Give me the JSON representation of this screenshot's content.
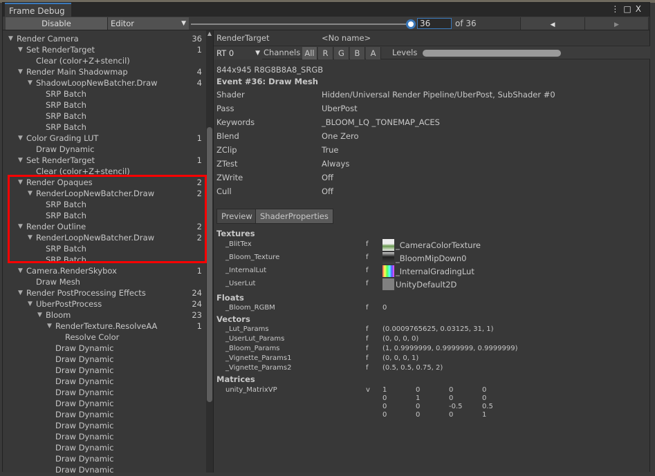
{
  "window": {
    "title": "Frame Debug",
    "menu_icon": "kebab-icon",
    "maximize_icon": "maximize-icon",
    "close_icon": "close-icon"
  },
  "toolbar": {
    "disable_label": "Disable",
    "target_select": "Editor",
    "event_index": "36",
    "event_total": "of 36",
    "event_fraction": 1.0,
    "prev_icon": "arrow-left-icon",
    "next_icon": "arrow-right-icon"
  },
  "tree": [
    {
      "label": "Render Camera",
      "count": "36",
      "level": 0,
      "expandable": true
    },
    {
      "label": "Set RenderTarget",
      "count": "1",
      "level": 1,
      "expandable": true
    },
    {
      "label": "Clear (color+Z+stencil)",
      "count": "",
      "level": 2,
      "expandable": false
    },
    {
      "label": "Render Main Shadowmap",
      "count": "4",
      "level": 1,
      "expandable": true
    },
    {
      "label": "ShadowLoopNewBatcher.Draw",
      "count": "4",
      "level": 2,
      "expandable": true
    },
    {
      "label": "SRP Batch",
      "count": "",
      "level": 3,
      "expandable": false
    },
    {
      "label": "SRP Batch",
      "count": "",
      "level": 3,
      "expandable": false
    },
    {
      "label": "SRP Batch",
      "count": "",
      "level": 3,
      "expandable": false
    },
    {
      "label": "SRP Batch",
      "count": "",
      "level": 3,
      "expandable": false
    },
    {
      "label": "Color Grading LUT",
      "count": "1",
      "level": 1,
      "expandable": true
    },
    {
      "label": "Draw Dynamic",
      "count": "",
      "level": 2,
      "expandable": false
    },
    {
      "label": "Set RenderTarget",
      "count": "1",
      "level": 1,
      "expandable": true
    },
    {
      "label": "Clear (color+Z+stencil)",
      "count": "",
      "level": 2,
      "expandable": false
    },
    {
      "label": "Render Opaques",
      "count": "2",
      "level": 1,
      "expandable": true
    },
    {
      "label": "RenderLoopNewBatcher.Draw",
      "count": "2",
      "level": 2,
      "expandable": true
    },
    {
      "label": "SRP Batch",
      "count": "",
      "level": 3,
      "expandable": false
    },
    {
      "label": "SRP Batch",
      "count": "",
      "level": 3,
      "expandable": false
    },
    {
      "label": "Render Outline",
      "count": "2",
      "level": 1,
      "expandable": true
    },
    {
      "label": "RenderLoopNewBatcher.Draw",
      "count": "2",
      "level": 2,
      "expandable": true
    },
    {
      "label": "SRP Batch",
      "count": "",
      "level": 3,
      "expandable": false
    },
    {
      "label": "SRP Batch",
      "count": "",
      "level": 3,
      "expandable": false
    },
    {
      "label": "Camera.RenderSkybox",
      "count": "1",
      "level": 1,
      "expandable": true
    },
    {
      "label": "Draw Mesh",
      "count": "",
      "level": 2,
      "expandable": false
    },
    {
      "label": "Render PostProcessing Effects",
      "count": "24",
      "level": 1,
      "expandable": true
    },
    {
      "label": "UberPostProcess",
      "count": "24",
      "level": 2,
      "expandable": true
    },
    {
      "label": "Bloom",
      "count": "23",
      "level": 3,
      "expandable": true
    },
    {
      "label": "RenderTexture.ResolveAA",
      "count": "1",
      "level": 4,
      "expandable": true
    },
    {
      "label": "Resolve Color",
      "count": "",
      "level": 5,
      "expandable": false
    },
    {
      "label": "Draw Dynamic",
      "count": "",
      "level": 4,
      "expandable": false
    },
    {
      "label": "Draw Dynamic",
      "count": "",
      "level": 4,
      "expandable": false
    },
    {
      "label": "Draw Dynamic",
      "count": "",
      "level": 4,
      "expandable": false
    },
    {
      "label": "Draw Dynamic",
      "count": "",
      "level": 4,
      "expandable": false
    },
    {
      "label": "Draw Dynamic",
      "count": "",
      "level": 4,
      "expandable": false
    },
    {
      "label": "Draw Dynamic",
      "count": "",
      "level": 4,
      "expandable": false
    },
    {
      "label": "Draw Dynamic",
      "count": "",
      "level": 4,
      "expandable": false
    },
    {
      "label": "Draw Dynamic",
      "count": "",
      "level": 4,
      "expandable": false
    },
    {
      "label": "Draw Dynamic",
      "count": "",
      "level": 4,
      "expandable": false
    },
    {
      "label": "Draw Dynamic",
      "count": "",
      "level": 4,
      "expandable": false
    },
    {
      "label": "Draw Dynamic",
      "count": "",
      "level": 4,
      "expandable": false
    },
    {
      "label": "Draw Dynamic",
      "count": "",
      "level": 4,
      "expandable": false
    }
  ],
  "highlight_color": "#ff0000",
  "details": {
    "render_target_label": "RenderTarget",
    "render_target_value": "<No name>",
    "rt_select": "RT 0",
    "channels_label": "Channels",
    "channels": [
      "All",
      "R",
      "G",
      "B",
      "A"
    ],
    "levels_label": "Levels",
    "format": "844x945 R8G8B8A8_SRGB",
    "event_title": "Event #36: Draw Mesh",
    "props": [
      {
        "k": "Shader",
        "v": "Hidden/Universal Render Pipeline/UberPost, SubShader #0"
      },
      {
        "k": "Pass",
        "v": "UberPost"
      },
      {
        "k": "Keywords",
        "v": "_BLOOM_LQ _TONEMAP_ACES"
      },
      {
        "k": "Blend",
        "v": "One Zero"
      },
      {
        "k": "ZClip",
        "v": "True"
      },
      {
        "k": "ZTest",
        "v": "Always"
      },
      {
        "k": "ZWrite",
        "v": "Off"
      },
      {
        "k": "Cull",
        "v": "Off"
      }
    ],
    "tabs": [
      "Preview",
      "ShaderProperties"
    ],
    "textures_header": "Textures",
    "textures": [
      {
        "name": "_BlitTex",
        "type": "f",
        "value": "_CameraColorTexture"
      },
      {
        "name": "_Bloom_Texture",
        "type": "f",
        "value": "_BloomMipDown0"
      },
      {
        "name": "_InternalLut",
        "type": "f",
        "value": "_InternalGradingLut"
      },
      {
        "name": "_UserLut",
        "type": "f",
        "value": "UnityDefault2D"
      }
    ],
    "floats_header": "Floats",
    "floats": [
      {
        "name": "_Bloom_RGBM",
        "type": "f",
        "value": "0"
      }
    ],
    "vectors_header": "Vectors",
    "vectors": [
      {
        "name": "_Lut_Params",
        "type": "f",
        "value": "(0.0009765625, 0.03125, 31, 1)"
      },
      {
        "name": "_UserLut_Params",
        "type": "f",
        "value": "(0, 0, 0, 0)"
      },
      {
        "name": "_Bloom_Params",
        "type": "f",
        "value": "(1, 0.9999999, 0.9999999, 0.9999999)"
      },
      {
        "name": "_Vignette_Params1",
        "type": "f",
        "value": "(0, 0, 0, 1)"
      },
      {
        "name": "_Vignette_Params2",
        "type": "f",
        "value": "(0.5, 0.5, 0.75, 2)"
      }
    ],
    "matrices_header": "Matrices",
    "matrix": {
      "name": "unity_MatrixVP",
      "type": "v",
      "rows": [
        [
          "1",
          "0",
          "0",
          "0"
        ],
        [
          "0",
          "1",
          "0",
          "0"
        ],
        [
          "0",
          "0",
          "-0.5",
          "0.5"
        ],
        [
          "0",
          "0",
          "0",
          "1"
        ]
      ]
    }
  }
}
